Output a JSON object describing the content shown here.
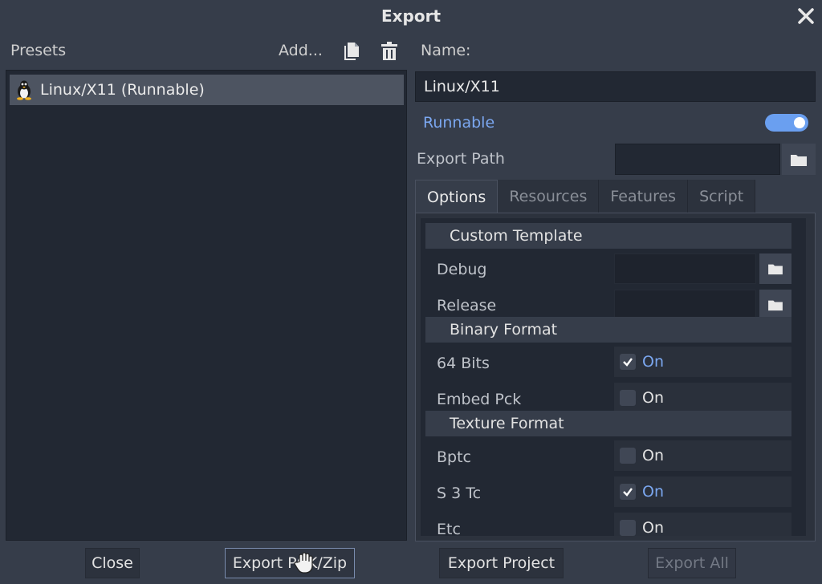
{
  "window": {
    "title": "Export"
  },
  "presets": {
    "label": "Presets",
    "add_label": "Add...",
    "items": [
      {
        "label": "Linux/X11 (Runnable)"
      }
    ]
  },
  "details": {
    "name_label": "Name:",
    "name_value": "Linux/X11",
    "runnable_label": "Runnable",
    "runnable_on": true,
    "export_path_label": "Export Path",
    "export_path_value": ""
  },
  "tabs": [
    {
      "label": "Options",
      "active": true
    },
    {
      "label": "Resources",
      "active": false
    },
    {
      "label": "Features",
      "active": false
    },
    {
      "label": "Script",
      "active": false
    }
  ],
  "options": {
    "custom_template": {
      "header": "Custom Template",
      "debug_label": "Debug",
      "release_label": "Release"
    },
    "binary_format": {
      "header": "Binary Format",
      "bits64_label": "64 Bits",
      "bits64_value": "On",
      "bits64_checked": true,
      "embed_pck_label": "Embed Pck",
      "embed_pck_value": "On",
      "embed_pck_checked": false
    },
    "texture_format": {
      "header": "Texture Format",
      "bptc_label": "Bptc",
      "bptc_value": "On",
      "bptc_checked": false,
      "s3tc_label": "S 3 Tc",
      "s3tc_value": "On",
      "s3tc_checked": true,
      "etc_label": "Etc",
      "etc_value": "On",
      "etc_checked": false
    }
  },
  "buttons": {
    "close": "Close",
    "export_pck": "Export PCK/Zip",
    "export_project": "Export Project",
    "export_all": "Export All"
  },
  "colors": {
    "background": "#363d4a",
    "accent": "#7ba7f0",
    "panel": "#222833"
  }
}
